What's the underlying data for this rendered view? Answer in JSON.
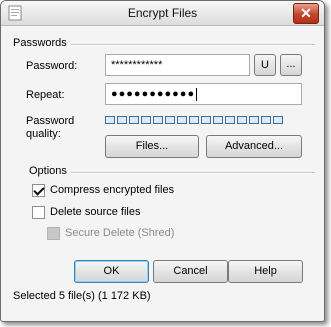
{
  "window": {
    "title": "Encrypt Files"
  },
  "passwords": {
    "group_label": "Passwords",
    "password_label": "Password:",
    "password_value": "************",
    "u_button": "U",
    "more_button": "...",
    "repeat_label": "Repeat:",
    "repeat_value": "●●●●●●●●●●●",
    "quality_label": "Password quality:",
    "quality_level": 0,
    "quality_segments": 15,
    "files_button": "Files...",
    "advanced_button": "Advanced..."
  },
  "options": {
    "group_label": "Options",
    "compress": {
      "label": "Compress encrypted files",
      "checked": true
    },
    "delete_source": {
      "label": "Delete source files",
      "checked": false
    },
    "secure_delete": {
      "label": "Secure Delete (Shred)",
      "checked": false,
      "disabled": true
    }
  },
  "buttons": {
    "ok": "OK",
    "cancel": "Cancel",
    "help": "Help"
  },
  "status": "Selected 5 file(s) (1 172 KB)"
}
